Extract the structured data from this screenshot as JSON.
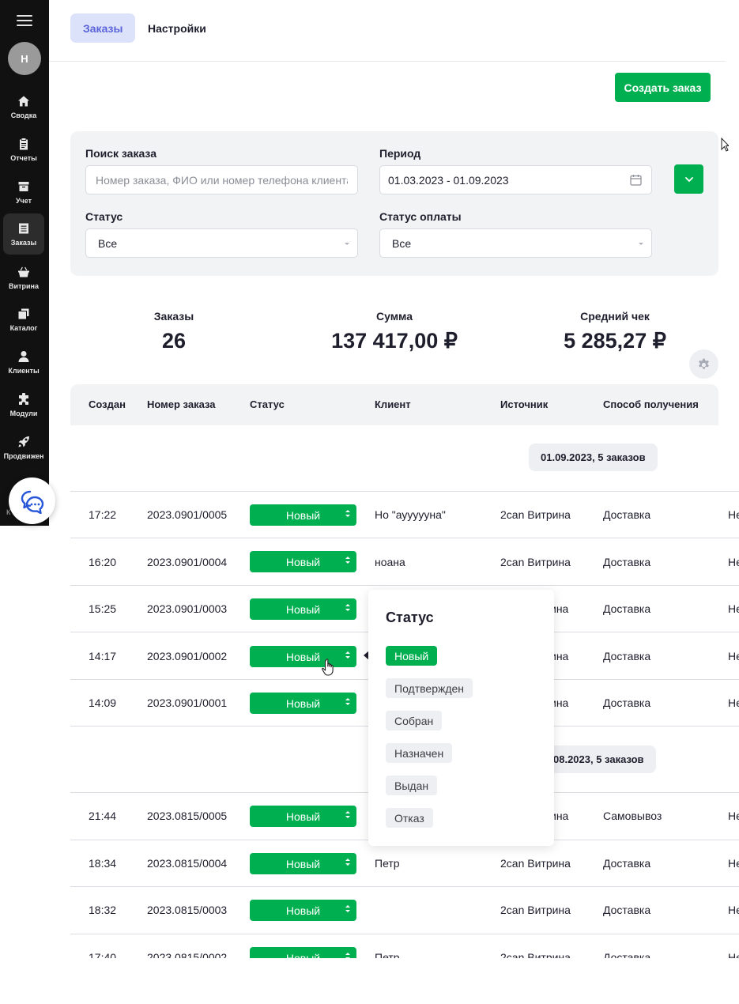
{
  "sidebar": {
    "avatar_letter": "Н",
    "items": [
      {
        "label": "Сводка",
        "icon": "home-icon"
      },
      {
        "label": "Отчеты",
        "icon": "clipboard-icon"
      },
      {
        "label": "Учет",
        "icon": "archive-icon"
      },
      {
        "label": "Заказы",
        "icon": "orders-icon"
      },
      {
        "label": "Витрина",
        "icon": "basket-icon"
      },
      {
        "label": "Каталог",
        "icon": "copy-icon"
      },
      {
        "label": "Клиенты",
        "icon": "user-icon"
      },
      {
        "label": "Модули",
        "icon": "puzzle-icon"
      },
      {
        "label": "Продвижен",
        "icon": "rocket-icon"
      }
    ],
    "active_item": "Заказы",
    "cut_label": "К"
  },
  "tabs": [
    {
      "label": "Заказы",
      "active": true
    },
    {
      "label": "Настройки",
      "active": false
    }
  ],
  "create_button": "Создать заказ",
  "filters": {
    "search_label": "Поиск заказа",
    "search_placeholder": "Номер заказа, ФИО или номер телефона клиента",
    "period_label": "Период",
    "period_value": "01.03.2023 - 01.09.2023",
    "status_label": "Статус",
    "status_value": "Все",
    "payment_label": "Статус оплаты",
    "payment_value": "Все"
  },
  "summary": {
    "orders_label": "Заказы",
    "orders_value": "26",
    "sum_label": "Сумма",
    "sum_value": "137 417,00 ₽",
    "avg_label": "Средний чек",
    "avg_value": "5 285,27 ₽"
  },
  "table": {
    "headers": [
      "Создан",
      "Номер заказа",
      "Статус",
      "Клиент",
      "Источник",
      "Способ получения"
    ],
    "groups": [
      {
        "label": "01.09.2023, 5 заказов",
        "rows": [
          {
            "time": "17:22",
            "number": "2023.0901/0005",
            "status": "Новый",
            "client": "Но \"ауууууна\"",
            "source": "2can Витрина",
            "delivery": "Доставка",
            "extra": "Не"
          },
          {
            "time": "16:20",
            "number": "2023.0901/0004",
            "status": "Новый",
            "client": "ноана",
            "source": "2can Витрина",
            "delivery": "Доставка",
            "extra": "Не"
          },
          {
            "time": "15:25",
            "number": "2023.0901/0003",
            "status": "Новый",
            "client": "",
            "source": "ина",
            "delivery": "Доставка",
            "extra": "Не"
          },
          {
            "time": "14:17",
            "number": "2023.0901/0002",
            "status": "Новый",
            "client": "",
            "source": "ина",
            "delivery": "Доставка",
            "extra": "Не"
          },
          {
            "time": "14:09",
            "number": "2023.0901/0001",
            "status": "Новый",
            "client": "",
            "source": "ина",
            "delivery": "Доставка",
            "extra": "Не"
          }
        ]
      },
      {
        "label": "08.2023, 5 заказов",
        "rows": [
          {
            "time": "21:44",
            "number": "2023.0815/0005",
            "status": "Новый",
            "client": "",
            "source": "ина",
            "delivery": "Самовывоз",
            "extra": "Не"
          },
          {
            "time": "18:34",
            "number": "2023.0815/0004",
            "status": "Новый",
            "client": "Петр",
            "source": "2can Витрина",
            "delivery": "Доставка",
            "extra": "Не"
          },
          {
            "time": "18:32",
            "number": "2023.0815/0003",
            "status": "Новый",
            "client": "",
            "source": "2can Витрина",
            "delivery": "Доставка",
            "extra": "Не"
          },
          {
            "time": "17:40",
            "number": "2023.0815/0002",
            "status": "Новый",
            "client": "Петр",
            "source": "2can Витрина",
            "delivery": "Доставка",
            "extra": "Не"
          }
        ]
      }
    ]
  },
  "status_popover": {
    "title": "Статус",
    "options": [
      "Новый",
      "Подтвержден",
      "Собран",
      "Назначен",
      "Выдан",
      "Отказ"
    ],
    "selected": "Новый"
  },
  "colors": {
    "accent_green": "#00b050",
    "sidebar_bg": "#111111",
    "active_tab_bg": "#dde2fb",
    "active_tab_text": "#5a64d9"
  }
}
